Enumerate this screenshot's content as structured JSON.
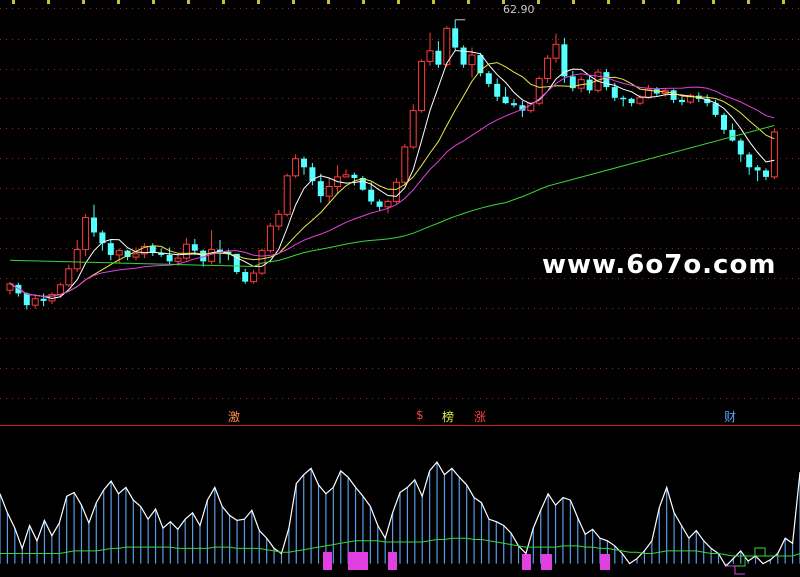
{
  "chart_data": [
    {
      "type": "candlestick",
      "high_label": "62.90",
      "candles": [
        [
          37.6,
          38.4,
          37.2,
          38.2
        ],
        [
          38.1,
          38.3,
          37.0,
          37.3
        ],
        [
          37.3,
          37.4,
          35.8,
          36.2
        ],
        [
          36.2,
          37.1,
          35.9,
          36.8
        ],
        [
          36.8,
          37.3,
          36.1,
          36.6
        ],
        [
          36.6,
          37.4,
          36.3,
          37.2
        ],
        [
          37.2,
          38.3,
          36.9,
          38.1
        ],
        [
          38.1,
          40.0,
          37.9,
          39.6
        ],
        [
          39.6,
          42.3,
          39.3,
          41.4
        ],
        [
          41.4,
          44.7,
          40.8,
          44.4
        ],
        [
          44.4,
          45.6,
          42.6,
          43.0
        ],
        [
          43.0,
          43.2,
          41.3,
          42.0
        ],
        [
          42.0,
          42.3,
          40.4,
          40.9
        ],
        [
          40.9,
          41.5,
          40.1,
          41.3
        ],
        [
          41.3,
          41.4,
          40.4,
          40.7
        ],
        [
          40.7,
          41.6,
          40.4,
          41.0
        ],
        [
          41.0,
          42.0,
          40.6,
          41.7
        ],
        [
          41.7,
          42.0,
          40.8,
          41.1
        ],
        [
          41.1,
          41.5,
          40.7,
          40.9
        ],
        [
          40.9,
          41.6,
          40.0,
          40.3
        ],
        [
          40.3,
          41.0,
          39.9,
          40.6
        ],
        [
          40.6,
          42.5,
          40.4,
          41.9
        ],
        [
          41.9,
          42.4,
          40.9,
          41.3
        ],
        [
          41.3,
          41.4,
          39.8,
          40.3
        ],
        [
          40.3,
          43.2,
          40.0,
          41.4
        ],
        [
          41.4,
          42.3,
          40.1,
          41.2
        ],
        [
          41.2,
          41.4,
          40.4,
          41.0
        ],
        [
          41.0,
          41.0,
          39.1,
          39.3
        ],
        [
          39.3,
          39.6,
          38.2,
          38.4
        ],
        [
          38.4,
          39.5,
          38.2,
          39.2
        ],
        [
          39.2,
          41.5,
          39.0,
          41.3
        ],
        [
          41.3,
          43.9,
          41.1,
          43.6
        ],
        [
          43.6,
          45.1,
          43.2,
          44.7
        ],
        [
          44.7,
          48.5,
          44.5,
          48.3
        ],
        [
          48.3,
          50.3,
          48.1,
          49.9
        ],
        [
          49.9,
          50.1,
          48.4,
          49.1
        ],
        [
          49.1,
          49.5,
          47.4,
          47.8
        ],
        [
          47.8,
          48.5,
          45.8,
          46.4
        ],
        [
          46.4,
          48.1,
          45.7,
          47.3
        ],
        [
          47.3,
          49.3,
          46.6,
          48.2
        ],
        [
          48.2,
          48.9,
          48.3,
          48.4
        ],
        [
          48.4,
          48.6,
          47.4,
          48.1
        ],
        [
          48.1,
          48.3,
          46.9,
          47.0
        ],
        [
          47.0,
          47.7,
          45.6,
          45.9
        ],
        [
          45.9,
          46.1,
          45.0,
          45.4
        ],
        [
          45.4,
          46.1,
          44.8,
          45.9
        ],
        [
          45.9,
          48.1,
          45.7,
          47.7
        ],
        [
          47.7,
          51.3,
          47.4,
          51.0
        ],
        [
          51.0,
          55.0,
          50.8,
          54.4
        ],
        [
          54.4,
          59.2,
          54.2,
          59.0
        ],
        [
          59.0,
          61.7,
          58.6,
          60.0
        ],
        [
          60.0,
          60.9,
          58.4,
          58.7
        ],
        [
          58.7,
          62.3,
          58.5,
          62.1
        ],
        [
          62.1,
          62.9,
          60.0,
          60.3
        ],
        [
          60.3,
          60.5,
          58.4,
          58.7
        ],
        [
          58.7,
          60.3,
          57.5,
          59.6
        ],
        [
          59.6,
          59.8,
          57.6,
          57.9
        ],
        [
          57.9,
          58.1,
          56.6,
          56.9
        ],
        [
          56.9,
          57.4,
          55.3,
          55.7
        ],
        [
          55.7,
          56.6,
          55.0,
          55.1
        ],
        [
          55.1,
          55.5,
          54.7,
          54.9
        ],
        [
          54.9,
          55.3,
          53.8,
          54.4
        ],
        [
          54.4,
          55.1,
          54.2,
          55.1
        ],
        [
          55.1,
          57.6,
          54.9,
          57.4
        ],
        [
          57.4,
          59.6,
          57.0,
          59.3
        ],
        [
          59.3,
          61.6,
          58.9,
          60.6
        ],
        [
          60.6,
          61.2,
          57.0,
          57.6
        ],
        [
          57.6,
          58.1,
          56.2,
          56.5
        ],
        [
          56.5,
          57.6,
          56.1,
          57.3
        ],
        [
          57.3,
          57.7,
          56.0,
          56.3
        ],
        [
          56.3,
          58.3,
          56.1,
          58.0
        ],
        [
          58.0,
          58.3,
          56.3,
          56.6
        ],
        [
          56.6,
          57.0,
          55.3,
          55.6
        ],
        [
          55.6,
          55.8,
          54.8,
          55.5
        ],
        [
          55.5,
          55.6,
          54.8,
          55.1
        ],
        [
          55.1,
          55.9,
          54.9,
          55.6
        ],
        [
          55.6,
          56.8,
          55.6,
          56.4
        ],
        [
          56.4,
          56.6,
          55.8,
          56.0
        ],
        [
          56.0,
          56.5,
          55.7,
          56.3
        ],
        [
          56.3,
          56.4,
          55.1,
          55.4
        ],
        [
          55.4,
          55.7,
          54.9,
          55.2
        ],
        [
          55.2,
          56.0,
          55.0,
          55.8
        ],
        [
          55.8,
          56.1,
          55.2,
          55.5
        ],
        [
          55.5,
          55.9,
          54.8,
          55.1
        ],
        [
          55.1,
          55.4,
          53.8,
          54.0
        ],
        [
          54.0,
          54.2,
          52.2,
          52.6
        ],
        [
          52.6,
          53.2,
          51.5,
          51.6
        ],
        [
          51.6,
          51.8,
          49.6,
          50.3
        ],
        [
          50.3,
          50.5,
          48.4,
          49.1
        ],
        [
          49.1,
          49.3,
          47.8,
          48.8
        ],
        [
          48.8,
          49.0,
          47.9,
          48.2
        ],
        [
          48.2,
          52.7,
          48.0,
          52.4
        ]
      ],
      "ma_periods": [
        5,
        10,
        20,
        60
      ],
      "ma_colors": [
        "#ffffff",
        "#e8e84a",
        "#e040e0",
        "#3ad53a"
      ],
      "up_color": "#ff3c3c",
      "down_color": "#54ffff",
      "grid_color": "#b02020",
      "ylim": [
        35,
        64
      ]
    },
    {
      "type": "bar",
      "bar_color": "#5a9ae6",
      "line_color": "#ffffff",
      "values": [
        55,
        40,
        28,
        12,
        30,
        18,
        34,
        22,
        32,
        53,
        56,
        46,
        32,
        48,
        58,
        65,
        55,
        60,
        50,
        45,
        35,
        43,
        28,
        33,
        27,
        35,
        40,
        30,
        50,
        60,
        45,
        38,
        34,
        35,
        42,
        26,
        20,
        12,
        8,
        28,
        63,
        70,
        75,
        62,
        55,
        60,
        73,
        68,
        60,
        53,
        45,
        30,
        20,
        40,
        56,
        60,
        66,
        53,
        73,
        80,
        70,
        75,
        68,
        62,
        52,
        48,
        35,
        33,
        30,
        24,
        14,
        8,
        28,
        42,
        55,
        46,
        52,
        50,
        36,
        23,
        27,
        20,
        18,
        14,
        8,
        0,
        4,
        10,
        18,
        44,
        60,
        40,
        30,
        20,
        26,
        18,
        12,
        8,
        -2,
        4,
        10,
        2,
        6,
        0,
        3,
        8,
        20,
        16,
        72
      ],
      "ma_values": [
        8,
        8,
        8,
        8,
        8,
        8,
        8,
        8,
        8,
        9,
        10,
        10,
        10,
        10,
        11,
        12,
        12,
        13,
        13,
        13,
        13,
        13,
        13,
        13,
        12,
        12,
        12,
        12,
        12,
        13,
        13,
        13,
        12,
        12,
        12,
        12,
        11,
        10,
        9,
        9,
        10,
        11,
        12,
        13,
        14,
        15,
        16,
        17,
        18,
        18,
        18,
        18,
        17,
        17,
        17,
        17,
        17,
        17,
        18,
        19,
        19,
        20,
        20,
        20,
        19,
        19,
        18,
        17,
        16,
        15,
        14,
        13,
        13,
        13,
        13,
        13,
        14,
        14,
        14,
        13,
        13,
        12,
        12,
        11,
        10,
        9,
        9,
        8,
        8,
        9,
        10,
        10,
        10,
        10,
        10,
        9,
        8,
        8,
        7,
        6,
        6,
        6,
        6,
        6,
        6,
        6,
        6,
        6,
        8
      ],
      "signal_color": "#e040e0",
      "signal_bars": [
        {
          "x": 323,
          "w": 9,
          "h": 18
        },
        {
          "x": 348,
          "w": 20,
          "h": 18
        },
        {
          "x": 388,
          "w": 9,
          "h": 18
        },
        {
          "x": 522,
          "w": 9,
          "h": 16
        },
        {
          "x": 541,
          "w": 11,
          "h": 16
        },
        {
          "x": 600,
          "w": 10,
          "h": 16
        }
      ],
      "markers": [
        {
          "text": "激",
          "color": "#ff8a4a"
        },
        {
          "text": "$",
          "color": "#ff4040"
        },
        {
          "text": "榜",
          "color": "#e8e84a"
        },
        {
          "text": "涨",
          "color": "#ff4040"
        },
        {
          "text": "财",
          "color": "#5aa0ff"
        }
      ],
      "ylim": [
        -5,
        80
      ]
    }
  ],
  "watermark": "www.6o7o.com"
}
